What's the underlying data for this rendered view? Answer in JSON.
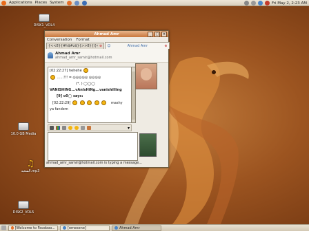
{
  "top_panel": {
    "menus": [
      "Applications",
      "Places",
      "System"
    ],
    "clock": "Fri May  2,  2:23 AM"
  },
  "desktop_icons": [
    {
      "label": "DISK1_VOL4"
    },
    {
      "label": "10.0 GB Media"
    },
    {
      "label": "السعيد.mp3"
    },
    {
      "label": "DISK2_VOL5"
    }
  ],
  "window": {
    "title": "Ahmad Amr",
    "menu": [
      "Conversation",
      "Format"
    ],
    "tabs": [
      {
        "label": "{<<8}{#h$#z$}{>>8}{i}{=20}"
      },
      {
        "label": "Ahmad Amr"
      }
    ],
    "contact": {
      "name": "Ahmad Amr",
      "email": "ahmad_amr_samir@hotmail.com"
    },
    "chat_lines": [
      "[02:22:27] hehehe",
      "......!!! =  ◎◎◎◎◎ ◎◎◎◎",
      "(*. ) ◯◯◯",
      "VANISHING...vAnIsHiNg...vanishiIIing",
      "[9] o0◯ says:",
      "[02:22:29]",
      "mashy",
      "ya fandem"
    ],
    "typing_status": "ahmad_amr_samir@hotmail.com is typing a message..."
  },
  "taskbar": [
    {
      "label": "[Welcome to Faceboo..."
    },
    {
      "label": "[emesene]"
    },
    {
      "label": "Ahmad Amr"
    }
  ],
  "colors": {
    "accent": "#c8763c",
    "desktop": "#9c5420"
  }
}
